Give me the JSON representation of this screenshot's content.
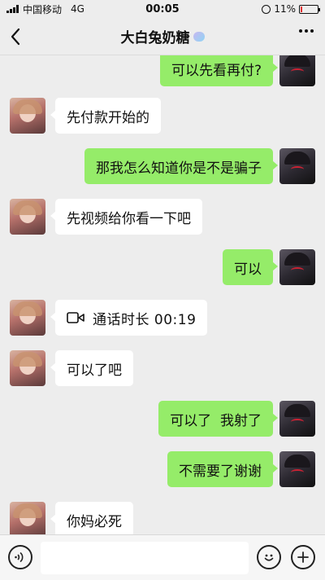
{
  "status_bar": {
    "carrier": "中国移动",
    "network": "4G",
    "time": "00:05",
    "battery": "11%",
    "battery_level": 0.11,
    "battery_color": "#e03030"
  },
  "header": {
    "title": "大白兔奶糖",
    "back_icon": "chevron-left-icon",
    "more_icon": "more-dots-icon"
  },
  "colors": {
    "sent_bubble": "#95ec69",
    "received_bubble": "#ffffff",
    "background": "#ededed"
  },
  "messages": [
    {
      "side": "right",
      "text": "可以先看再付?"
    },
    {
      "side": "left",
      "text": "先付款开始的"
    },
    {
      "side": "right",
      "text": "那我怎么知道你是不是骗子"
    },
    {
      "side": "left",
      "text": "先视频给你看一下吧"
    },
    {
      "side": "right",
      "text": "可以"
    },
    {
      "side": "left",
      "type": "video-call",
      "icon": "video-camera-icon",
      "text": "通话时长 00:19"
    },
    {
      "side": "left",
      "text": "可以了吧"
    },
    {
      "side": "right",
      "text": "可以了  我射了"
    },
    {
      "side": "right",
      "text": "不需要了谢谢"
    },
    {
      "side": "left",
      "text": "你妈必死"
    }
  ],
  "input_bar": {
    "value": "",
    "voice_icon": "voice-icon",
    "emoji_icon": "emoji-icon",
    "plus_icon": "plus-icon"
  }
}
